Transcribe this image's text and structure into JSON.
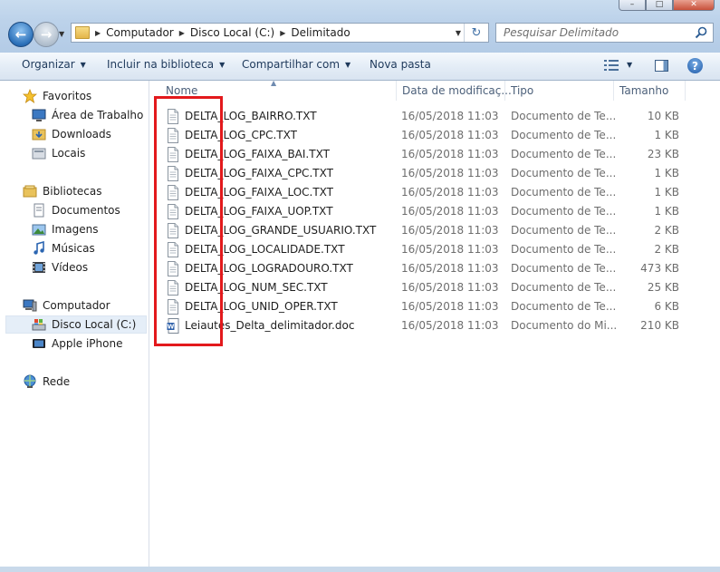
{
  "window": {
    "minimize": "–",
    "maximize": "□",
    "close": "✕"
  },
  "address": {
    "crumbs": [
      "Computador",
      "Disco Local (C:)",
      "Delimitado"
    ]
  },
  "search": {
    "placeholder": "Pesquisar Delimitado"
  },
  "toolbar": {
    "organize": "Organizar",
    "include": "Incluir na biblioteca",
    "share": "Compartilhar com",
    "new_folder": "Nova pasta"
  },
  "nav": {
    "favorites": "Favoritos",
    "desktop": "Área de Trabalho",
    "downloads": "Downloads",
    "places": "Locais",
    "libraries": "Bibliotecas",
    "documents": "Documentos",
    "images": "Imagens",
    "music": "Músicas",
    "videos": "Vídeos",
    "computer": "Computador",
    "local_disk": "Disco Local (C:)",
    "iphone": "Apple iPhone",
    "network": "Rede"
  },
  "columns": {
    "name": "Nome",
    "date": "Data de modificaç...",
    "type": "Tipo",
    "size": "Tamanho"
  },
  "files": [
    {
      "name": "DELTA_LOG_BAIRRO.TXT",
      "date": "16/05/2018 11:03",
      "type": "Documento de Te...",
      "size": "10 KB",
      "icon": "text-file-icon"
    },
    {
      "name": "DELTA_LOG_CPC.TXT",
      "date": "16/05/2018 11:03",
      "type": "Documento de Te...",
      "size": "1 KB",
      "icon": "text-file-icon"
    },
    {
      "name": "DELTA_LOG_FAIXA_BAI.TXT",
      "date": "16/05/2018 11:03",
      "type": "Documento de Te...",
      "size": "23 KB",
      "icon": "text-file-icon"
    },
    {
      "name": "DELTA_LOG_FAIXA_CPC.TXT",
      "date": "16/05/2018 11:03",
      "type": "Documento de Te...",
      "size": "1 KB",
      "icon": "text-file-icon"
    },
    {
      "name": "DELTA_LOG_FAIXA_LOC.TXT",
      "date": "16/05/2018 11:03",
      "type": "Documento de Te...",
      "size": "1 KB",
      "icon": "text-file-icon"
    },
    {
      "name": "DELTA_LOG_FAIXA_UOP.TXT",
      "date": "16/05/2018 11:03",
      "type": "Documento de Te...",
      "size": "1 KB",
      "icon": "text-file-icon"
    },
    {
      "name": "DELTA_LOG_GRANDE_USUARIO.TXT",
      "date": "16/05/2018 11:03",
      "type": "Documento de Te...",
      "size": "2 KB",
      "icon": "text-file-icon"
    },
    {
      "name": "DELTA_LOG_LOCALIDADE.TXT",
      "date": "16/05/2018 11:03",
      "type": "Documento de Te...",
      "size": "2 KB",
      "icon": "text-file-icon"
    },
    {
      "name": "DELTA_LOG_LOGRADOURO.TXT",
      "date": "16/05/2018 11:03",
      "type": "Documento de Te...",
      "size": "473 KB",
      "icon": "text-file-icon"
    },
    {
      "name": "DELTA_LOG_NUM_SEC.TXT",
      "date": "16/05/2018 11:03",
      "type": "Documento de Te...",
      "size": "25 KB",
      "icon": "text-file-icon"
    },
    {
      "name": "DELTA_LOG_UNID_OPER.TXT",
      "date": "16/05/2018 11:03",
      "type": "Documento de Te...",
      "size": "6 KB",
      "icon": "text-file-icon"
    },
    {
      "name": "Leiautes_Delta_delimitador.doc",
      "date": "16/05/2018 11:03",
      "type": "Documento do Mi...",
      "size": "210 KB",
      "icon": "word-doc-icon"
    }
  ],
  "colors": {
    "highlight": "#e3191c",
    "accent": "#1e395b"
  }
}
